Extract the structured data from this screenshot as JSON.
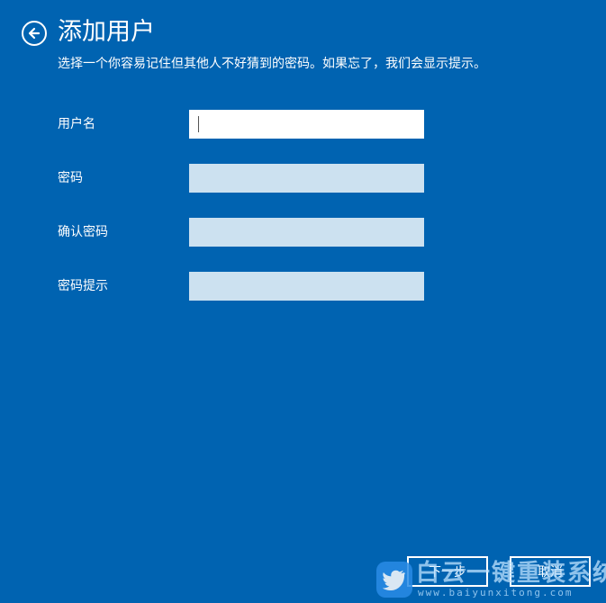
{
  "header": {
    "title": "添加用户",
    "subtitle": "选择一个你容易记住但其他人不好猜到的密码。如果忘了，我们会显示提示。"
  },
  "form": {
    "username_label": "用户名",
    "username_value": "",
    "password_label": "密码",
    "password_value": "",
    "confirm_label": "确认密码",
    "confirm_value": "",
    "hint_label": "密码提示",
    "hint_value": ""
  },
  "buttons": {
    "next_label": "下一步",
    "cancel_label": "取消"
  },
  "watermark": {
    "name": "白云一键重装系统",
    "url": "www.baiyunxitong.com",
    "logo_icon": "bird-icon"
  },
  "colors": {
    "background": "#0063b1",
    "text": "#ffffff",
    "input_active": "#ffffff",
    "input_inactive": "#cce1f0"
  }
}
